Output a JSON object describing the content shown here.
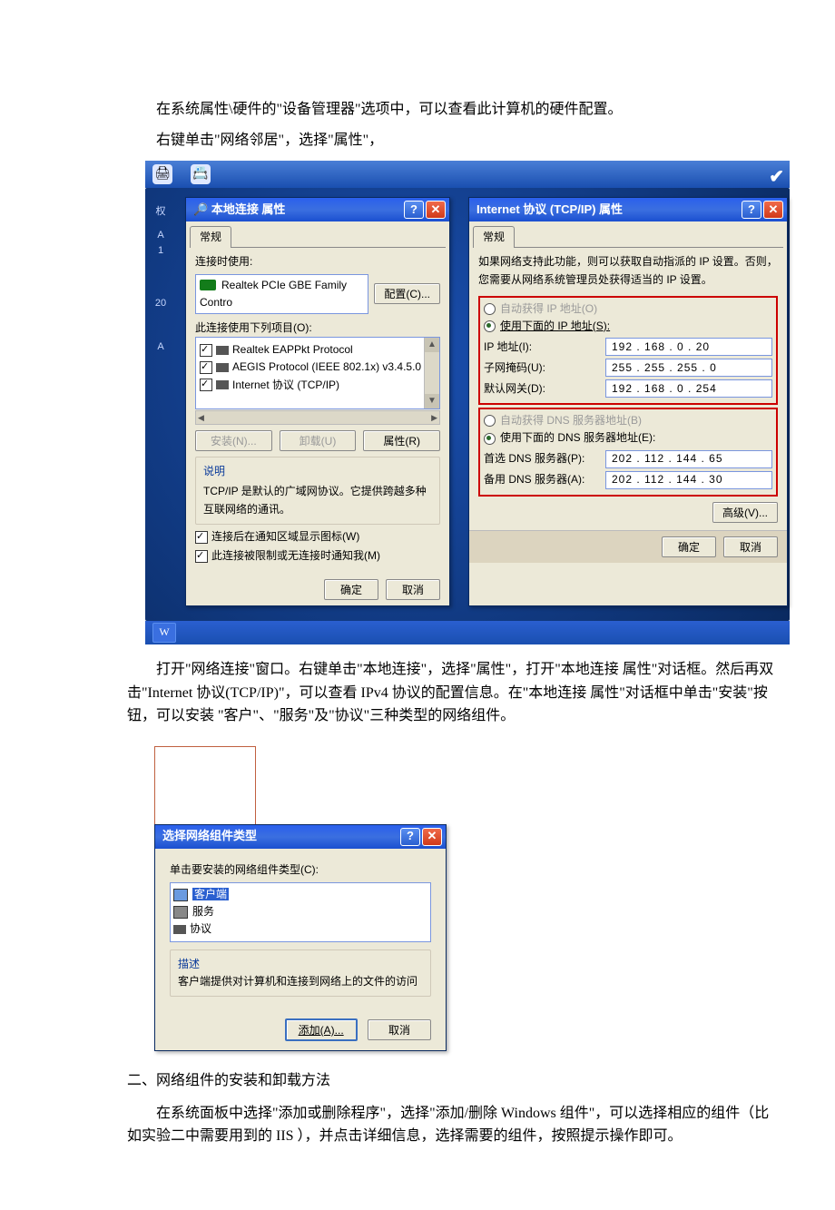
{
  "paragraphs": {
    "p1": "在系统属性\\硬件的\"设备管理器\"选项中，可以查看此计算机的硬件配置。",
    "p2": "右键单击\"网络邻居\"，选择\"属性\"，",
    "p3": "打开\"网络连接\"窗口。右键单击\"本地连接\"，选择\"属性\"，打开\"本地连接 属性\"对话框。然后再双击\"Internet 协议(TCP/IP)\"，可以查看 IPv4 协议的配置信息。在\"本地连接 属性\"对话框中单击\"安装\"按钮，可以安装 \"客户\"、\"服务\"及\"协议\"三种类型的网络组件。",
    "h2": "二、网络组件的安装和卸载方法",
    "p4": "在系统面板中选择\"添加或删除程序\"，选择\"添加/删除 Windows 组件\"，可以选择相应的组件（比如实验二中需要用到的 IIS ），并点击详细信息，选择需要的组件，按照提示操作即可。"
  },
  "dialog1": {
    "title": "本地连接 属性",
    "tab": "常规",
    "connect_using": "连接时使用:",
    "adapter": "Realtek PCIe GBE Family Contro",
    "configure_btn": "配置(C)...",
    "items_label": "此连接使用下列项目(O):",
    "items": {
      "a": "Realtek EAPPkt Protocol",
      "b": "AEGIS Protocol (IEEE 802.1x) v3.4.5.0",
      "c": "Internet 协议 (TCP/IP)"
    },
    "install_btn": "安装(N)...",
    "uninstall_btn": "卸载(U)",
    "properties_btn": "属性(R)",
    "desc_title": "说明",
    "desc_text": "TCP/IP 是默认的广域网协议。它提供跨越多种互联网络的通讯。",
    "cb1": "连接后在通知区域显示图标(W)",
    "cb2": "此连接被限制或无连接时通知我(M)",
    "ok": "确定",
    "cancel": "取消"
  },
  "dialog2": {
    "title": "Internet 协议 (TCP/IP) 属性",
    "tab": "常规",
    "note": "如果网络支持此功能，则可以获取自动指派的 IP 设置。否则，您需要从网络系统管理员处获得适当的 IP 设置。",
    "auto_ip": "自动获得 IP 地址(O)",
    "use_ip": "使用下面的 IP 地址(S):",
    "lbl_ip": "IP 地址(I):",
    "val_ip": "192 . 168 .  0  .  20",
    "lbl_mask": "子网掩码(U):",
    "val_mask": "255 . 255 . 255 .  0",
    "lbl_gw": "默认网关(D):",
    "val_gw": "192 . 168 .  0  . 254",
    "auto_dns": "自动获得 DNS 服务器地址(B)",
    "use_dns": "使用下面的 DNS 服务器地址(E):",
    "lbl_dns1": "首选 DNS 服务器(P):",
    "val_dns1": "202 . 112 . 144 .  65",
    "lbl_dns2": "备用 DNS 服务器(A):",
    "val_dns2": "202 . 112 . 144 .  30",
    "adv_btn": "高级(V)...",
    "ok": "确定",
    "cancel": "取消"
  },
  "dialog3": {
    "title": "选择网络组件类型",
    "prompt": "单击要安装的网络组件类型(C):",
    "types": {
      "client": "客户端",
      "service": "服务",
      "protocol": "协议"
    },
    "desc_title": "描述",
    "desc_text": "客户端提供对计算机和连接到网络上的文件的访问",
    "add_btn": "添加(A)...",
    "cancel_btn": "取消"
  }
}
